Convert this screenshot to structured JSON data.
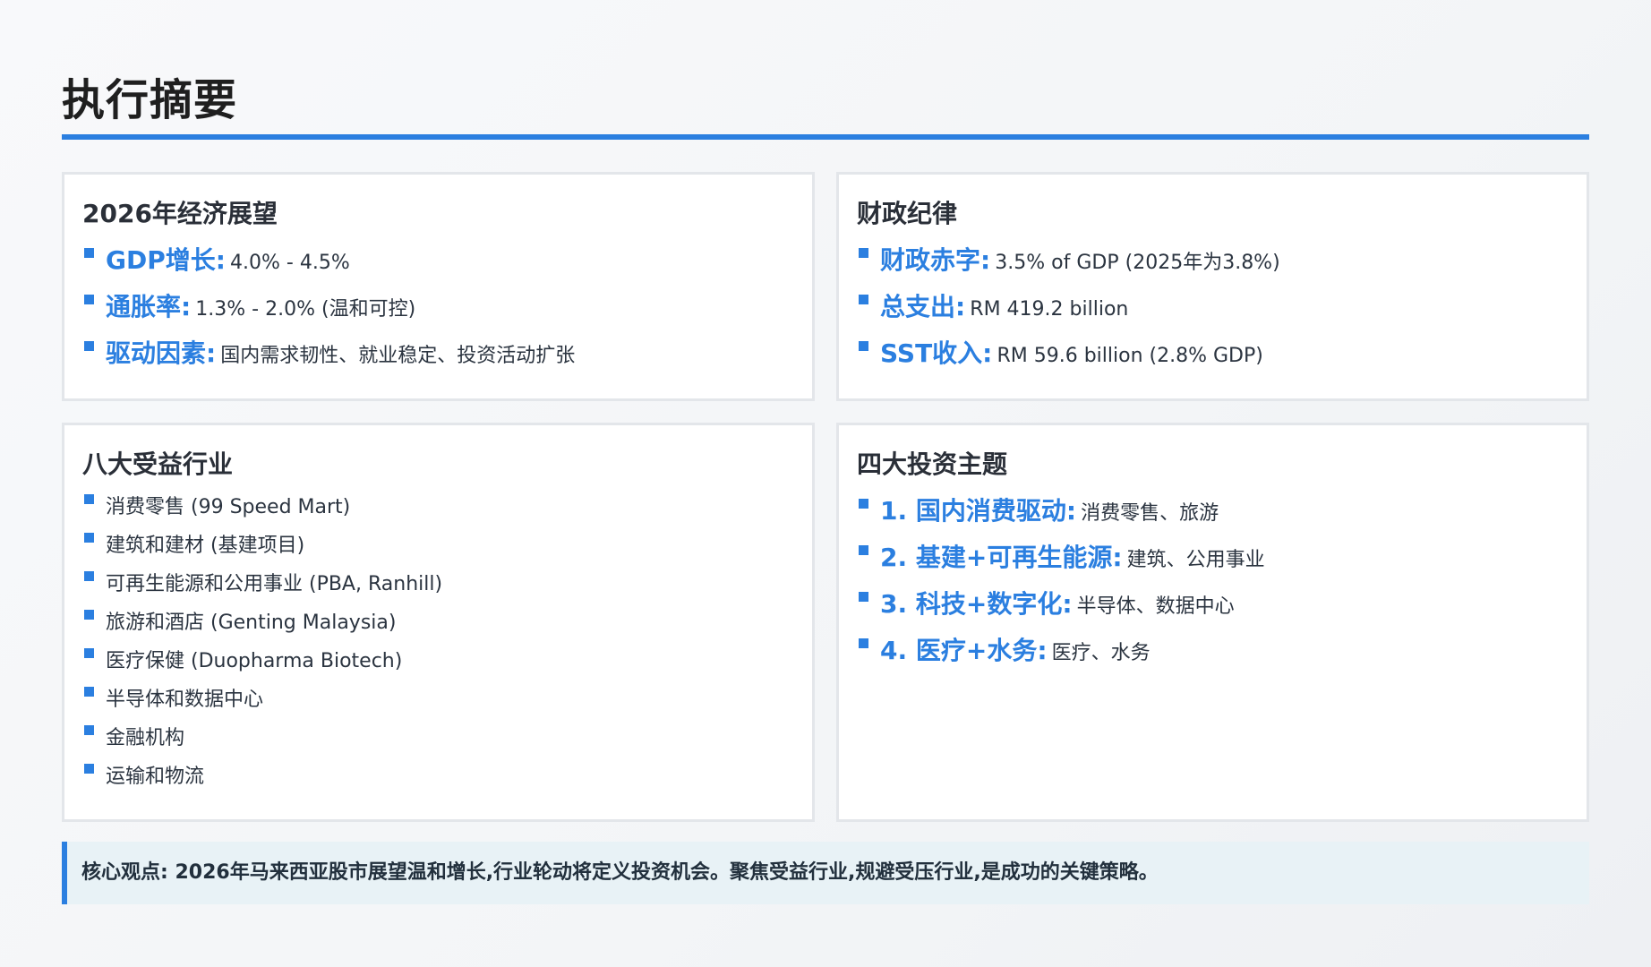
{
  "page_title": "执行摘要",
  "colors": {
    "accent": "#2b7fe0",
    "card_border": "#e3e6ea",
    "core_bg": "#e8f2f6"
  },
  "economic_outlook": {
    "title": "2026年经济展望",
    "items": [
      {
        "key": "GDP增长:",
        "value": "4.0% - 4.5%"
      },
      {
        "key": "通胀率:",
        "value": "1.3% - 2.0% (温和可控)"
      },
      {
        "key": "驱动因素:",
        "value": "国内需求韧性、就业稳定、投资活动扩张"
      }
    ]
  },
  "fiscal_discipline": {
    "title": "财政纪律",
    "items": [
      {
        "key": "财政赤字:",
        "value": "3.5% of GDP (2025年为3.8%)"
      },
      {
        "key": "总支出:",
        "value": "RM 419.2 billion"
      },
      {
        "key": "SST收入:",
        "value": "RM 59.6 billion (2.8% GDP)"
      }
    ]
  },
  "beneficiary_sectors": {
    "title": "八大受益行业",
    "items": [
      "消费零售 (99 Speed Mart)",
      "建筑和建材 (基建项目)",
      "可再生能源和公用事业 (PBA, Ranhill)",
      "旅游和酒店 (Genting Malaysia)",
      "医疗保健 (Duopharma Biotech)",
      "半导体和数据中心",
      "金融机构",
      "运输和物流"
    ]
  },
  "investment_themes": {
    "title": "四大投资主题",
    "items": [
      {
        "key": "1. 国内消费驱动:",
        "value": "消费零售、旅游"
      },
      {
        "key": "2. 基建+可再生能源:",
        "value": "建筑、公用事业"
      },
      {
        "key": "3. 科技+数字化:",
        "value": "半导体、数据中心"
      },
      {
        "key": "4. 医疗+水务:",
        "value": "医疗、水务"
      }
    ]
  },
  "core_view": "核心观点: 2026年马来西亚股市展望温和增长,行业轮动将定义投资机会。聚焦受益行业,规避受压行业,是成功的关键策略。"
}
